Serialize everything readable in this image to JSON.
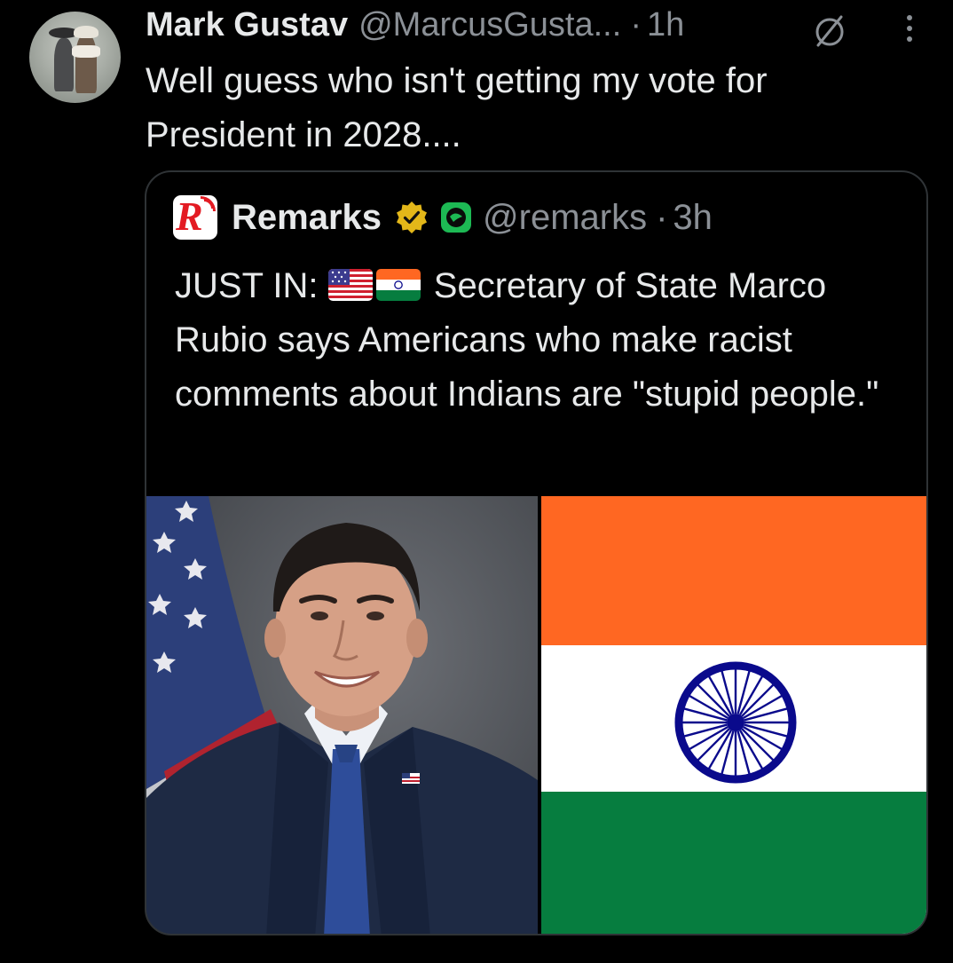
{
  "tweet": {
    "display_name": "Mark Gustav",
    "handle": "@MarcusGusta...",
    "separator": "·",
    "time": "1h",
    "text": "Well guess who isn't getting my vote for President in 2028....",
    "avatar_icon": "avatar-photo",
    "mute_icon": "mute-icon",
    "more_icon": "more-vertical-icon"
  },
  "quote": {
    "logo_letter": "R",
    "display_name": "Remarks",
    "verified_icon": "verified-badge-icon",
    "verified_color": "#e3b719",
    "affiliate_icon": "affiliate-badge-icon",
    "affiliate_color": "#1db954",
    "handle": "@remarks",
    "separator": "·",
    "time": "3h",
    "text_lead": "JUST IN:",
    "text_body": "Secretary of State Marco Rubio says Americans who make racist comments about Indians are \"stupid people.\"",
    "media": {
      "left": "photo-portrait-with-us-flag",
      "right": "indian-flag"
    }
  },
  "colors": {
    "background": "#000000",
    "text_primary": "#e7e9ea",
    "text_secondary": "#8b9096",
    "border": "#2f3336",
    "saffron": "#ff6722",
    "india_green": "#067d3f",
    "chakra_blue": "#0a0a8c",
    "brand_red": "#e31b23"
  }
}
